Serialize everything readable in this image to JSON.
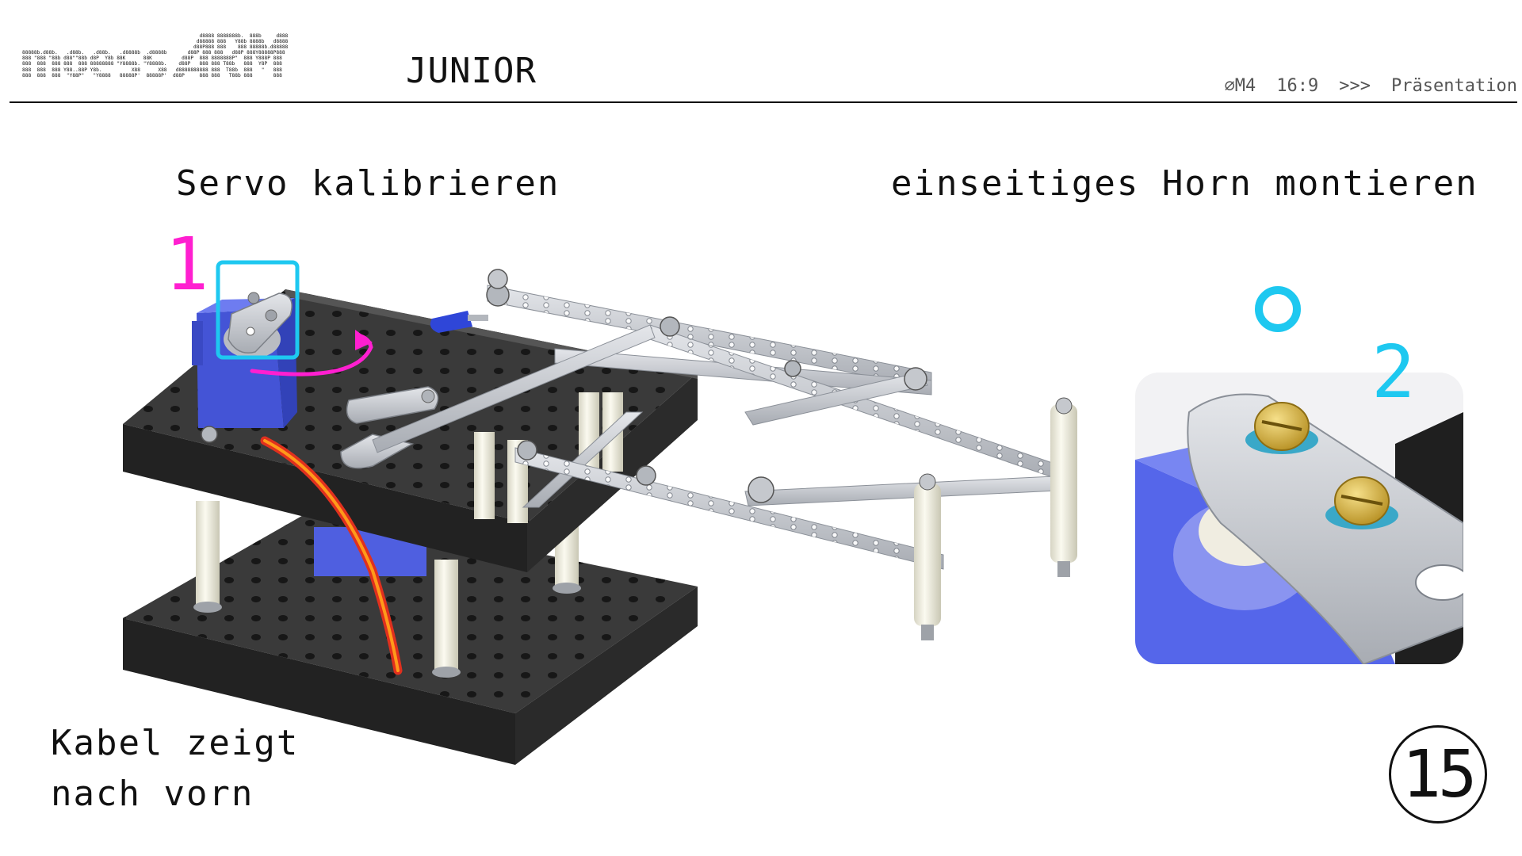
{
  "header": {
    "logo_ascii": "                                                            d8888 8888888b.  888b     d888\n                                                           d88888 888   Y88b 8888b   d8888\n                                                          d88P888 888    888 88888b.d88888\n88888b.d88b.   .d88b.   .d88b.   .d8888b  .d8888b       d88P 888 888   d88P 888Y88888P888\n888 \"888 \"88b d88\"\"88b d8P  Y8b 88K      88K          d88P  888 8888888P\"  888 Y888P 888\n888  888  888 888  888 88888888 \"Y8888b. \"Y8888b.    d88P   888 888 T88b   888  Y8P  888\n888  888  888 Y88..88P Y8b.          X88      X88   d8888888888 888  T88b  888   \"   888\n888  888  888  \"Y88P\"   \"Y8888   88888P'  88888P'  d88P     888 888   T88b 888       888",
    "junior_label": "JUNIOR",
    "meta": {
      "screw": "⌀M4",
      "ratio": "16:9",
      "arrows": ">>>",
      "mode": "Präsentation"
    }
  },
  "content": {
    "title_left": "Servo kalibrieren",
    "title_right": "einseitiges Horn montieren",
    "step_1": "1",
    "step_2": "2",
    "note_line1": "Kabel zeigt",
    "note_line2": "nach vorn",
    "page_number": "15"
  },
  "colors": {
    "magenta": "#ff1fd0",
    "cyan": "#1ec8f0",
    "servo_blue": "#4f5fe0",
    "board": "#2c2c2c",
    "metal": "#c9ccd1",
    "spacer": "#ecebdc",
    "brass": "#d8b843",
    "cable_red": "#e0301e",
    "cable_orange": "#ff9a1a"
  },
  "icons": {
    "rotate_arrow": "rotate-arrow-icon",
    "hole_marker": "hole-marker-icon"
  }
}
